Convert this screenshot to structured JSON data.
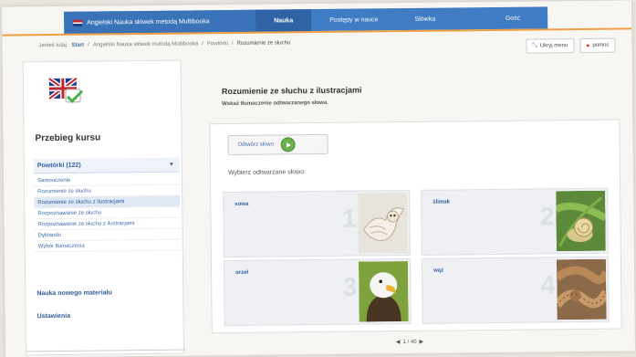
{
  "topnav": {
    "brand": "Angielski Nauka słówek metodą Multibooka",
    "items": [
      {
        "label": "Nauka",
        "active": true
      },
      {
        "label": "Postępy w nauce",
        "active": false
      },
      {
        "label": "Słówka",
        "active": false
      }
    ],
    "user": "Gość"
  },
  "breadcrumb": {
    "prefix": "Jesteś tutaj:",
    "items": [
      "Start",
      "Angielski Nauka słówek metodą Multibooka",
      "Powtórki",
      "Rozumienie ze słuchu"
    ]
  },
  "top_buttons": {
    "menu": "Ukryj menu",
    "help": "pomoc"
  },
  "sidebar": {
    "title": "Przebieg kursu",
    "section": "Powtórki (122)",
    "subitems": [
      {
        "label": "Samouczenie",
        "active": false
      },
      {
        "label": "Rozumienie ze słuchu",
        "active": false
      },
      {
        "label": "Rozumienie ze słuchu z ilustracjami",
        "active": true
      },
      {
        "label": "Rozpoznawanie ze słuchu",
        "active": false
      },
      {
        "label": "Rozpoznawanie ze słuchu z ilustracjami",
        "active": false
      },
      {
        "label": "Dyktando",
        "active": false
      },
      {
        "label": "Wybór tłumaczenia",
        "active": false
      }
    ],
    "links": [
      "Nauka nowego materiału",
      "Ustawienia"
    ]
  },
  "main": {
    "title": "Rozumienie ze słuchu z ilustracjami",
    "instruction": "Wskaż tłumaczenie odtwarzanego słowa.",
    "play_label": "Odtwórz słowo",
    "prompt": "Wybierz odtwarzane słowo:",
    "cards": [
      {
        "word": "sowa",
        "number": "1",
        "image": "owl"
      },
      {
        "word": "ślimak",
        "number": "2",
        "image": "snail"
      },
      {
        "word": "orzeł",
        "number": "3",
        "image": "eagle"
      },
      {
        "word": "wąż",
        "number": "4",
        "image": "snake"
      }
    ],
    "pager": "1 / 40"
  },
  "colors": {
    "nav": "#3f7cc4",
    "accent_orange": "#f0a040",
    "link": "#2f5d9c",
    "play_green": "#6ab04c"
  }
}
